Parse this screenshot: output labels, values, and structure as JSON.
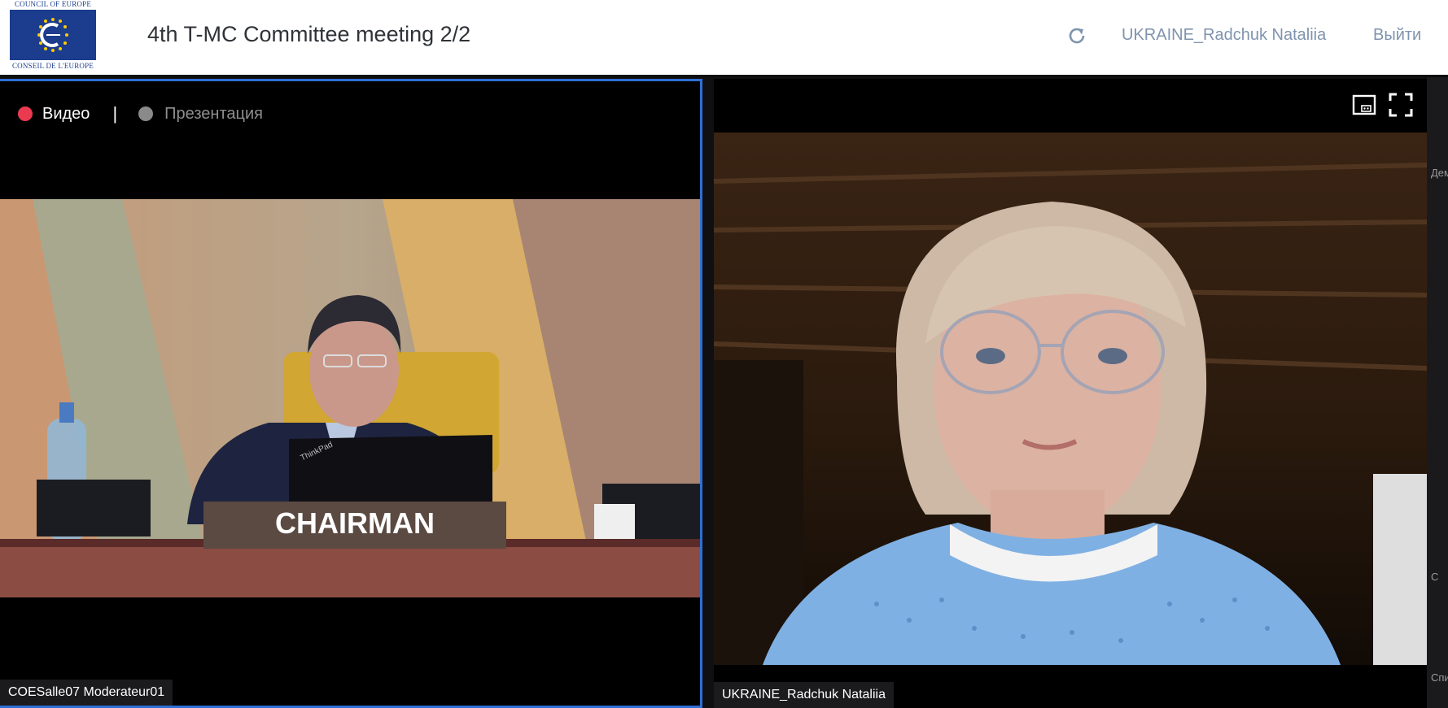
{
  "header": {
    "logo": {
      "top_text": "COUNCIL OF EUROPE",
      "bottom_text": "CONSEIL DE L'EUROPE",
      "flag_color": "#1c3d8e",
      "star_color": "#ffcc00"
    },
    "meeting_title": "4th T-MC Committee meeting 2/2",
    "refresh_icon": "refresh-icon",
    "user_name": "UKRAINE_Radchuk Nataliia",
    "logout_label": "Выйти"
  },
  "left_panel": {
    "modes": {
      "video_label": "Видео",
      "video_dot_color": "#ea3a4f",
      "separator": "|",
      "presentation_label": "Презентация",
      "presentation_dot_color": "#8a8a8a"
    },
    "video_feed": {
      "nameplate": "CHAIRMAN",
      "laptop_brand": "ThinkPad"
    },
    "name_tag": "COESalle07 Moderateur01"
  },
  "right_panel": {
    "tile_icons": [
      "picture-in-picture-icon",
      "fullscreen-icon"
    ],
    "name_tag": "UKRAINE_Radchuk Nataliia"
  },
  "side_strip": {
    "labels": [
      "Дем",
      "С",
      "Спи"
    ]
  },
  "colors": {
    "active_border": "#2f6fd6",
    "header_link": "#7f93ae"
  }
}
